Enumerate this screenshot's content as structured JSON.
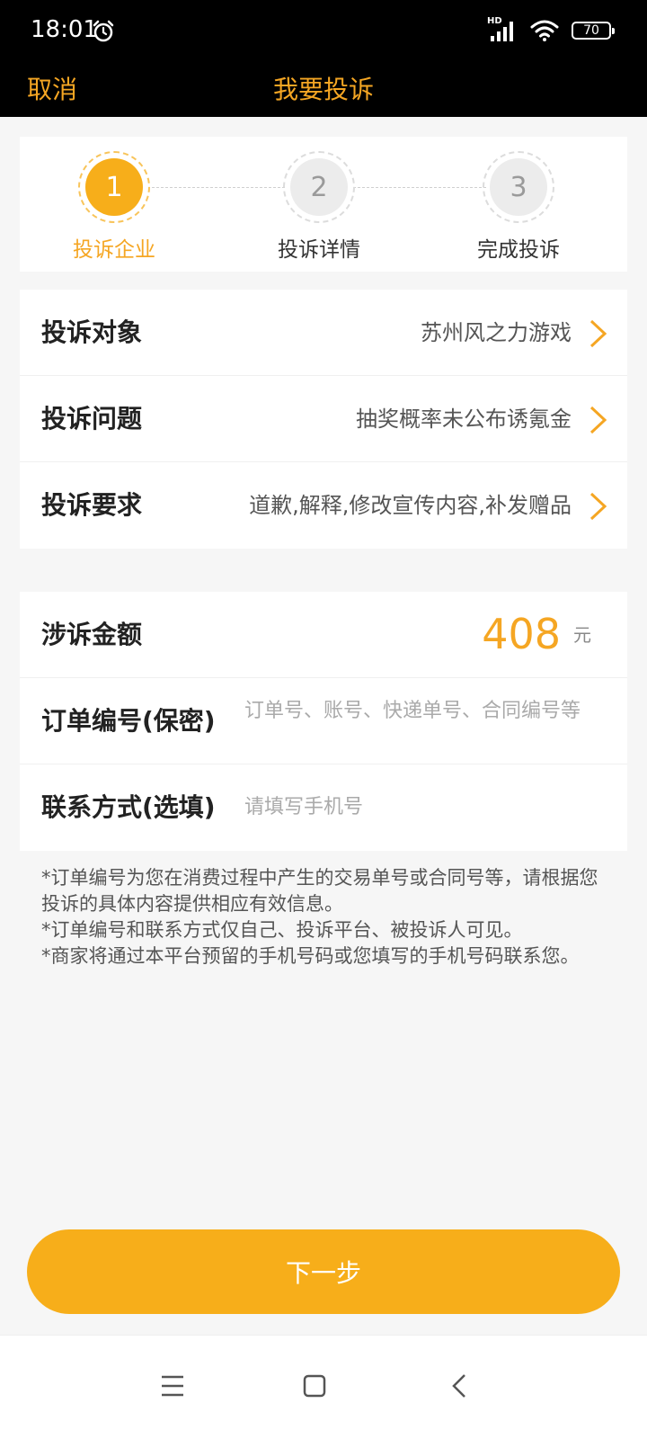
{
  "status": {
    "time": "18:01",
    "battery": "70",
    "network": "HD"
  },
  "header": {
    "cancel": "取消",
    "title": "我要投诉"
  },
  "steps": [
    {
      "num": "1",
      "label": "投诉企业"
    },
    {
      "num": "2",
      "label": "投诉详情"
    },
    {
      "num": "3",
      "label": "完成投诉"
    }
  ],
  "complaint": {
    "target_label": "投诉对象",
    "target_value": "苏州风之力游戏",
    "issue_label": "投诉问题",
    "issue_value": "抽奖概率未公布诱氪金",
    "demand_label": "投诉要求",
    "demand_value": "道歉,解释,修改宣传内容,补发赠品"
  },
  "details": {
    "amount_label": "涉诉金额",
    "amount_value": "408",
    "amount_unit": "元",
    "order_label": "订单编号(保密)",
    "order_placeholder": "订单号、账号、快递单号、合同编号等",
    "contact_label": "联系方式(选填)",
    "contact_placeholder": "请填写手机号"
  },
  "notes": [
    "*订单编号为您在消费过程中产生的交易单号或合同号等，请根据您投诉的具体内容提供相应有效信息。",
    "*订单编号和联系方式仅自己、投诉平台、被投诉人可见。",
    "*商家将通过本平台预留的手机号码或您填写的手机号码联系您。"
  ],
  "next_button": "下一步",
  "colors": {
    "accent": "#f7ae1a",
    "accent_text": "#f5a623",
    "header_bg": "#000000"
  }
}
